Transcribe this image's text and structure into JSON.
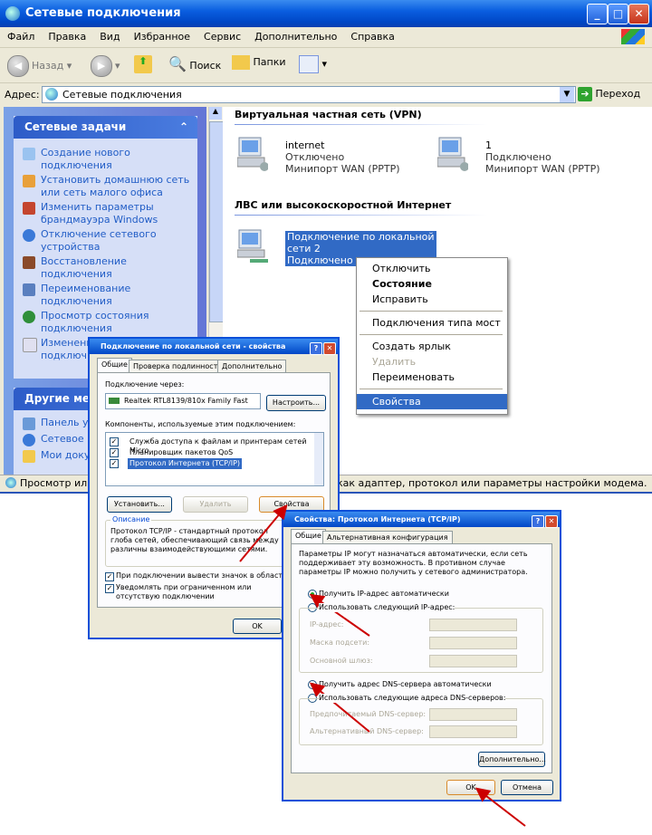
{
  "window": {
    "title": "Сетевые подключения",
    "menu": [
      "Файл",
      "Правка",
      "Вид",
      "Избранное",
      "Сервис",
      "Дополнительно",
      "Справка"
    ],
    "toolbar": {
      "back": "Назад",
      "search": "Поиск",
      "folders": "Папки"
    },
    "address": {
      "label": "Адрес:",
      "value": "Сетевые подключения",
      "go": "Переход"
    },
    "status": "Просмотр или",
    "status_tail": "как адаптер, протокол или параметры настройки модема."
  },
  "left_panel": {
    "tasks_header": "Сетевые задачи",
    "tasks": [
      "Создание нового подключения",
      "Установить домашнюю сеть или сеть малого офиса",
      "Изменить параметры брандмауэра Windows",
      "Отключение сетевого устройства",
      "Восстановление подключения",
      "Переименование подключения",
      "Просмотр состояния подключения",
      "Изменени подключ"
    ],
    "other_header": "Другие мес",
    "other": [
      "Панель у",
      "Сетевое",
      "Мои доку"
    ]
  },
  "content": {
    "vpn_group": "Виртуальная частная сеть (VPN)",
    "vpn_items": [
      {
        "name": "internet",
        "status": "Отключено",
        "device": "Минипорт WAN (PPTP)"
      },
      {
        "name": "1",
        "status": "Подключено",
        "device": "Минипорт WAN (PPTP)"
      }
    ],
    "lan_group": "ЛВС или высокоскоростной Интернет",
    "lan_item": {
      "name_line1": "Подключение по локальной",
      "name_line2": "сети 2",
      "status": "Подключено"
    }
  },
  "context_menu": [
    "Отключить",
    "Состояние",
    "Исправить",
    "Подключения типа мост",
    "Создать ярлык",
    "Удалить",
    "Переименовать",
    "Свойства"
  ],
  "dialog1": {
    "title": "Подключение по локальной сети - свойства",
    "tabs": [
      "Общие",
      "Проверка подлинности",
      "Дополнительно"
    ],
    "connect_via": "Подключение через:",
    "adapter": "Realtek RTL8139/810x Family Fast",
    "configure": "Настроить...",
    "components_label": "Компоненты, используемые этим подключением:",
    "components": [
      "Служба доступа к файлам и принтерам сетей Micro",
      "Планировщик пакетов QoS",
      "Протокол Интернета (TCP/IP)"
    ],
    "install": "Установить...",
    "remove": "Удалить",
    "properties": "Свойства",
    "description_label": "Описание",
    "description": "Протокол TCP/IP - стандартный протокол глоба сетей, обеспечивающий связь между различны взаимодействующими сетями.",
    "show_icon": "При подключении вывести значок в области уве",
    "notify": "Уведомлять при ограниченном или отсутствую подключении",
    "ok": "OK"
  },
  "dialog2": {
    "title": "Свойства: Протокол Интернета (TCP/IP)",
    "tabs": [
      "Общие",
      "Альтернативная конфигурация"
    ],
    "intro": "Параметры IP могут назначаться автоматически, если сеть поддерживает эту возможность. В противном случае параметры IP можно получить у сетевого администратора.",
    "auto_ip": "Получить IP-адрес автоматически",
    "manual_ip": "Использовать следующий IP-адрес:",
    "ip_label": "IP-адрес:",
    "mask_label": "Маска подсети:",
    "gateway_label": "Основной шлюз:",
    "auto_dns": "Получить адрес DNS-сервера автоматически",
    "manual_dns": "Использовать следующие адреса DNS-серверов:",
    "dns1": "Предпочитаемый DNS-сервер:",
    "dns2": "Альтернативный DNS-сервер:",
    "advanced": "Дополнительно...",
    "ok": "OK",
    "cancel": "Отмена"
  },
  "colors": {
    "xp_blue": "#0a5ee0",
    "selection": "#316ac5",
    "arrow": "#cc0000"
  }
}
